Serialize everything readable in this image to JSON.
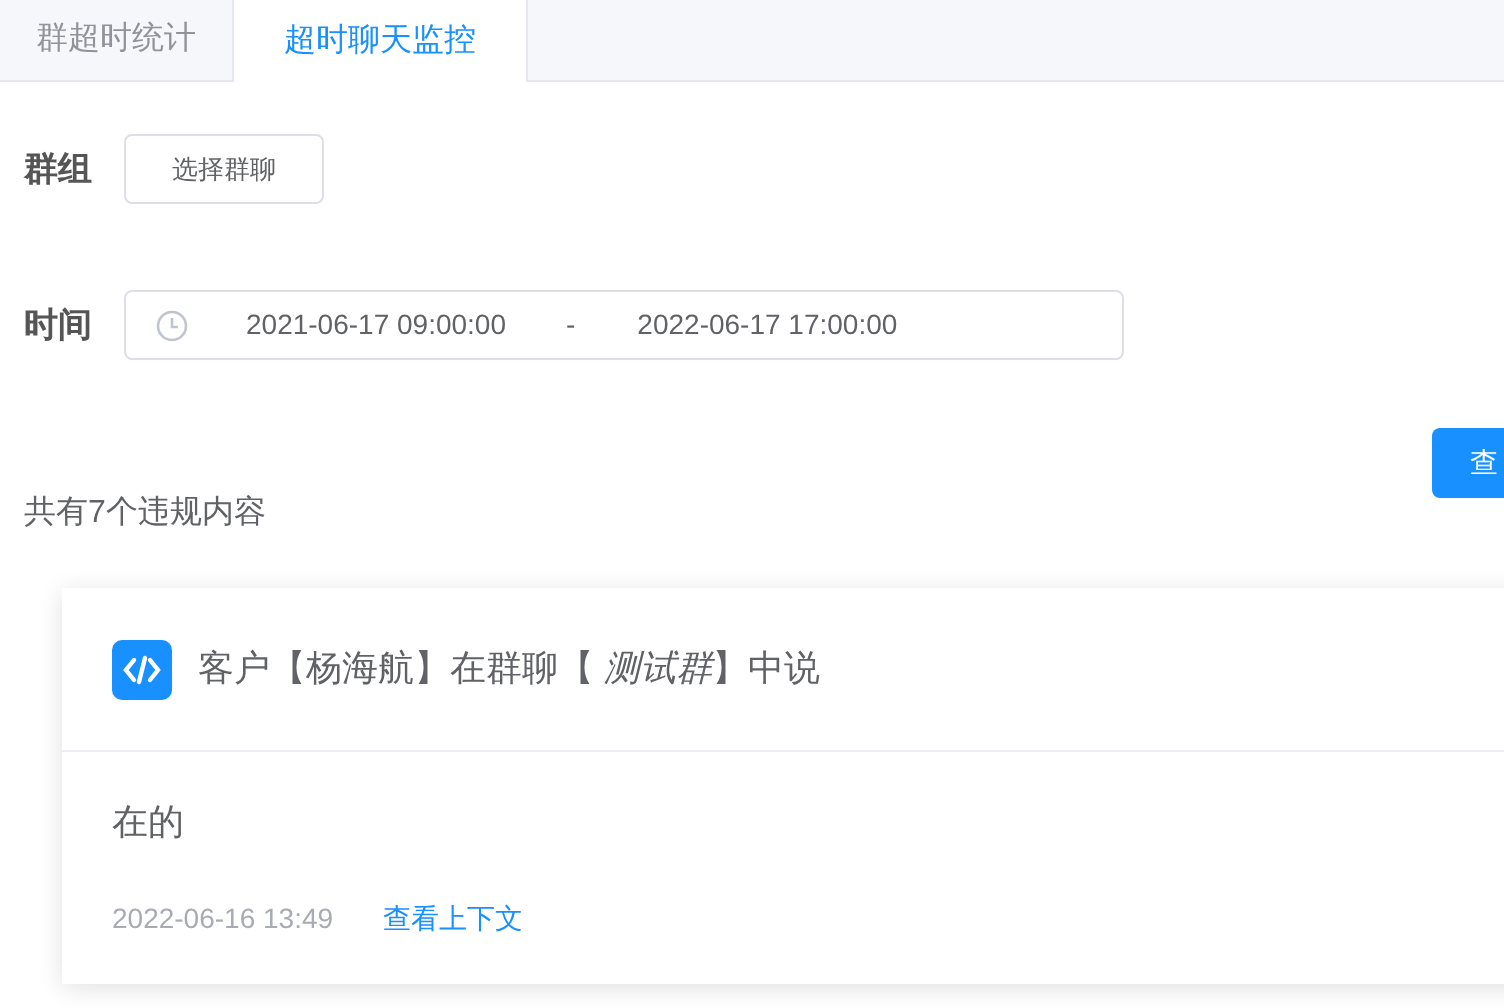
{
  "tabs": [
    {
      "label": "群超时统计",
      "selected": false
    },
    {
      "label": "超时聊天监控",
      "selected": true
    }
  ],
  "filters": [
    {
      "kind": "button",
      "label": "群组",
      "value": "选择群聊"
    },
    {
      "kind": "daterange",
      "label": "时间",
      "start": "2021-06-17 09:00:00",
      "separator": "-",
      "end": "2022-06-17 17:00:00"
    }
  ],
  "query_button": "查",
  "summary": "共有7个违规内容",
  "messages": [
    {
      "title": "客户【杨海航】在群聊【 *测试群*】中说",
      "content": "在的",
      "time": "2022-06-16 13:49",
      "link": "查看上下文"
    }
  ]
}
